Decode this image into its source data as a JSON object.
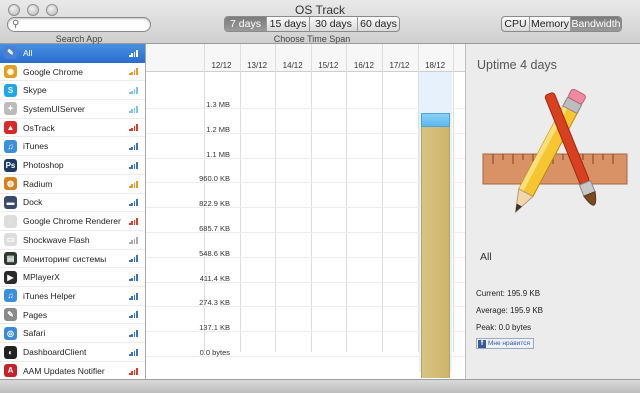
{
  "window": {
    "title": "OS Track"
  },
  "search": {
    "value": "",
    "placeholder": "",
    "caption": "Search App"
  },
  "time_span": {
    "caption": "Choose Time Span",
    "options": [
      "7 days",
      "15 days",
      "30 days",
      "60 days"
    ],
    "selected": "7 days"
  },
  "metric": {
    "options": [
      "CPU",
      "Memory",
      "Bandwidth"
    ],
    "selected": "Bandwidth"
  },
  "apps": [
    {
      "name": "All",
      "icon": "all-apps-icon",
      "color": "#4a7fd4",
      "selected": true,
      "bars_color": "#ffffff"
    },
    {
      "name": "Google Chrome",
      "icon": "chrome-icon",
      "color": "#e0a020",
      "bars_color": "#e89a2a"
    },
    {
      "name": "Skype",
      "icon": "skype-icon",
      "color": "#1fa5e8",
      "bars_color": "#7cc3ee"
    },
    {
      "name": "SystemUIServer",
      "icon": "systemuiserver-icon",
      "color": "#bbbbbb",
      "bars_color": "#7cc3ee"
    },
    {
      "name": "OsTrack",
      "icon": "ostrack-icon",
      "color": "#d8282a",
      "bars_color": "#e23a2a"
    },
    {
      "name": "iTunes",
      "icon": "itunes-icon",
      "color": "#3b8fdc",
      "bars_color": "#3a70c8"
    },
    {
      "name": "Photoshop",
      "icon": "photoshop-icon",
      "color": "#1c3a66",
      "bars_color": "#3a70c8"
    },
    {
      "name": "Radium",
      "icon": "radium-icon",
      "color": "#d8801e",
      "bars_color": "#e89a2a"
    },
    {
      "name": "Dock",
      "icon": "dock-icon",
      "color": "#3a4a6a",
      "bars_color": "#3a70c8"
    },
    {
      "name": "Google Chrome Renderer",
      "icon": "chrome-renderer-icon",
      "color": "#dddddd",
      "bars_color": "#e23a2a"
    },
    {
      "name": "Shockwave Flash",
      "icon": "shockwave-flash-icon",
      "color": "#dddddd",
      "bars_color": "#aaaaaa"
    },
    {
      "name": "Мониторинг системы",
      "icon": "activity-monitor-icon",
      "color": "#2e3a2e",
      "bars_color": "#3a70c8"
    },
    {
      "name": "MPlayerX",
      "icon": "mplayerx-icon",
      "color": "#2a2a2a",
      "bars_color": "#3a70c8"
    },
    {
      "name": "iTunes Helper",
      "icon": "itunes-helper-icon",
      "color": "#3b8fdc",
      "bars_color": "#3a70c8"
    },
    {
      "name": "Pages",
      "icon": "pages-icon",
      "color": "#8a8a8a",
      "bars_color": "#3a70c8"
    },
    {
      "name": "Safari",
      "icon": "safari-icon",
      "color": "#3a8ad8",
      "bars_color": "#3a70c8"
    },
    {
      "name": "DashboardClient",
      "icon": "dashboard-icon",
      "color": "#222222",
      "bars_color": "#3a70c8"
    },
    {
      "name": "AAM Updates Notifier",
      "icon": "aam-updates-icon",
      "color": "#c8202a",
      "bars_color": "#e23a2a"
    }
  ],
  "chart_data": {
    "type": "bar",
    "categories": [
      "12/12",
      "13/12",
      "14/12",
      "15/12",
      "16/12",
      "17/12",
      "18/12"
    ],
    "values_bytes": [
      0,
      0,
      0,
      0,
      0,
      0,
      195900
    ],
    "capacity_bytes": [
      0,
      0,
      0,
      0,
      0,
      0,
      1300000
    ],
    "yticks": [
      "0.0 bytes",
      "137.1 KB",
      "274.3 KB",
      "411.4 KB",
      "548.6 KB",
      "685.7 KB",
      "822.9 KB",
      "960.0 KB",
      "1.1 MB",
      "1.2 MB",
      "1.3 MB"
    ],
    "ytick_values": [
      0,
      137100,
      274300,
      411400,
      548600,
      685700,
      822900,
      960000,
      1100000,
      1200000,
      1300000
    ],
    "grid": true
  },
  "detail": {
    "uptime": "Uptime 4 days",
    "app_icon": "xcode-instruments-icon",
    "selected_app": "All",
    "current": "Current: 195.9 KB",
    "average": "Average: 195.9 KB",
    "peak": "Peak: 0.0 bytes",
    "like_label": "Мне нравится",
    "like_icon": "facebook-icon"
  }
}
